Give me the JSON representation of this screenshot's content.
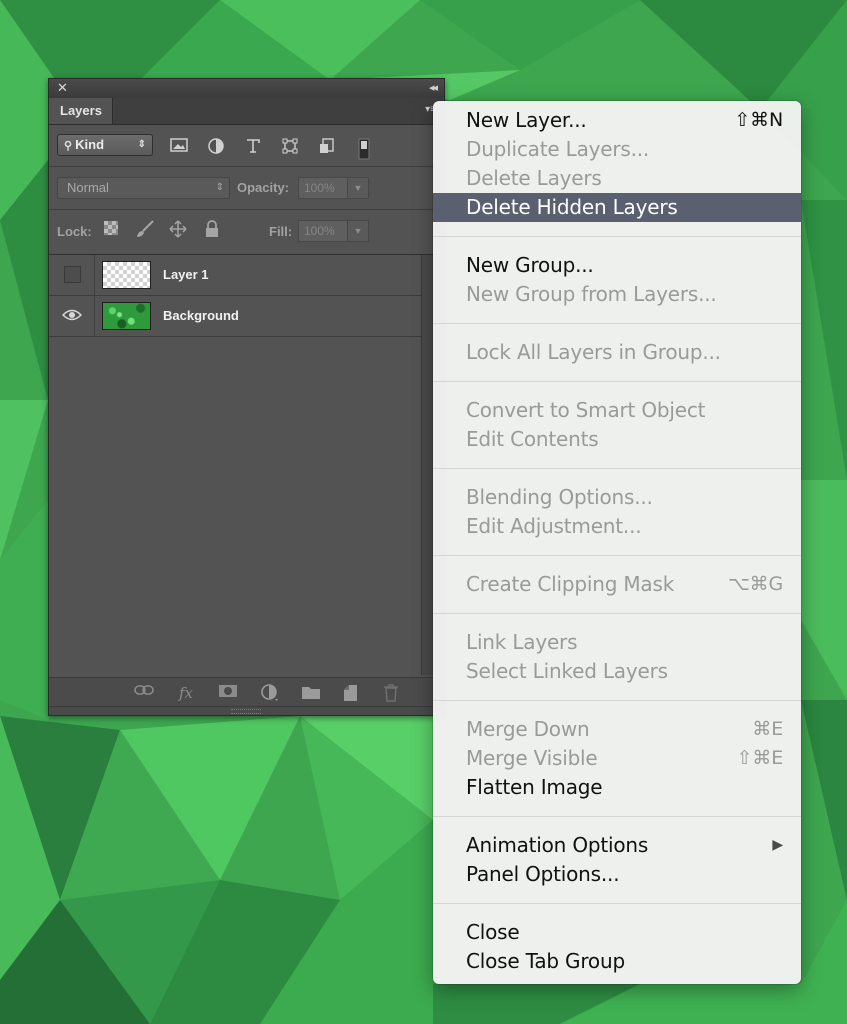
{
  "panel": {
    "close_glyph": "✕",
    "collapse_glyph": "◂◂",
    "tab_label": "Layers",
    "menu_glyph": "▾≡",
    "kind_label": "Kind",
    "blend_mode": "Normal",
    "opacity_label": "Opacity:",
    "opacity_value": "100%",
    "lock_label": "Lock:",
    "fill_label": "Fill:",
    "fill_value": "100%",
    "layers": [
      {
        "name": "Layer 1",
        "visible": false
      },
      {
        "name": "Background",
        "visible": true
      }
    ],
    "footer_fx": "fx"
  },
  "menu": {
    "groups": [
      [
        {
          "label": "New Layer...",
          "shortcut": "⇧⌘N",
          "disabled": false,
          "highlight": false
        },
        {
          "label": "Duplicate Layers...",
          "shortcut": "",
          "disabled": true,
          "highlight": false
        },
        {
          "label": "Delete Layers",
          "shortcut": "",
          "disabled": true,
          "highlight": false
        },
        {
          "label": "Delete Hidden Layers",
          "shortcut": "",
          "disabled": false,
          "highlight": true
        }
      ],
      [
        {
          "label": "New Group...",
          "shortcut": "",
          "disabled": false,
          "highlight": false
        },
        {
          "label": "New Group from Layers...",
          "shortcut": "",
          "disabled": true,
          "highlight": false
        }
      ],
      [
        {
          "label": "Lock All Layers in Group...",
          "shortcut": "",
          "disabled": true,
          "highlight": false
        }
      ],
      [
        {
          "label": "Convert to Smart Object",
          "shortcut": "",
          "disabled": true,
          "highlight": false
        },
        {
          "label": "Edit Contents",
          "shortcut": "",
          "disabled": true,
          "highlight": false
        }
      ],
      [
        {
          "label": "Blending Options...",
          "shortcut": "",
          "disabled": true,
          "highlight": false
        },
        {
          "label": "Edit Adjustment...",
          "shortcut": "",
          "disabled": true,
          "highlight": false
        }
      ],
      [
        {
          "label": "Create Clipping Mask",
          "shortcut": "⌥⌘G",
          "disabled": true,
          "highlight": false
        }
      ],
      [
        {
          "label": "Link Layers",
          "shortcut": "",
          "disabled": true,
          "highlight": false
        },
        {
          "label": "Select Linked Layers",
          "shortcut": "",
          "disabled": true,
          "highlight": false
        }
      ],
      [
        {
          "label": "Merge Down",
          "shortcut": "⌘E",
          "disabled": true,
          "highlight": false
        },
        {
          "label": "Merge Visible",
          "shortcut": "⇧⌘E",
          "disabled": true,
          "highlight": false
        },
        {
          "label": "Flatten Image",
          "shortcut": "",
          "disabled": false,
          "highlight": false
        }
      ],
      [
        {
          "label": "Animation Options",
          "shortcut": "",
          "disabled": false,
          "highlight": false,
          "submenu": true
        },
        {
          "label": "Panel Options...",
          "shortcut": "",
          "disabled": false,
          "highlight": false
        }
      ],
      [
        {
          "label": "Close",
          "shortcut": "",
          "disabled": false,
          "highlight": false
        },
        {
          "label": "Close Tab Group",
          "shortcut": "",
          "disabled": false,
          "highlight": false
        }
      ]
    ],
    "submenu_arrow": "▶"
  }
}
